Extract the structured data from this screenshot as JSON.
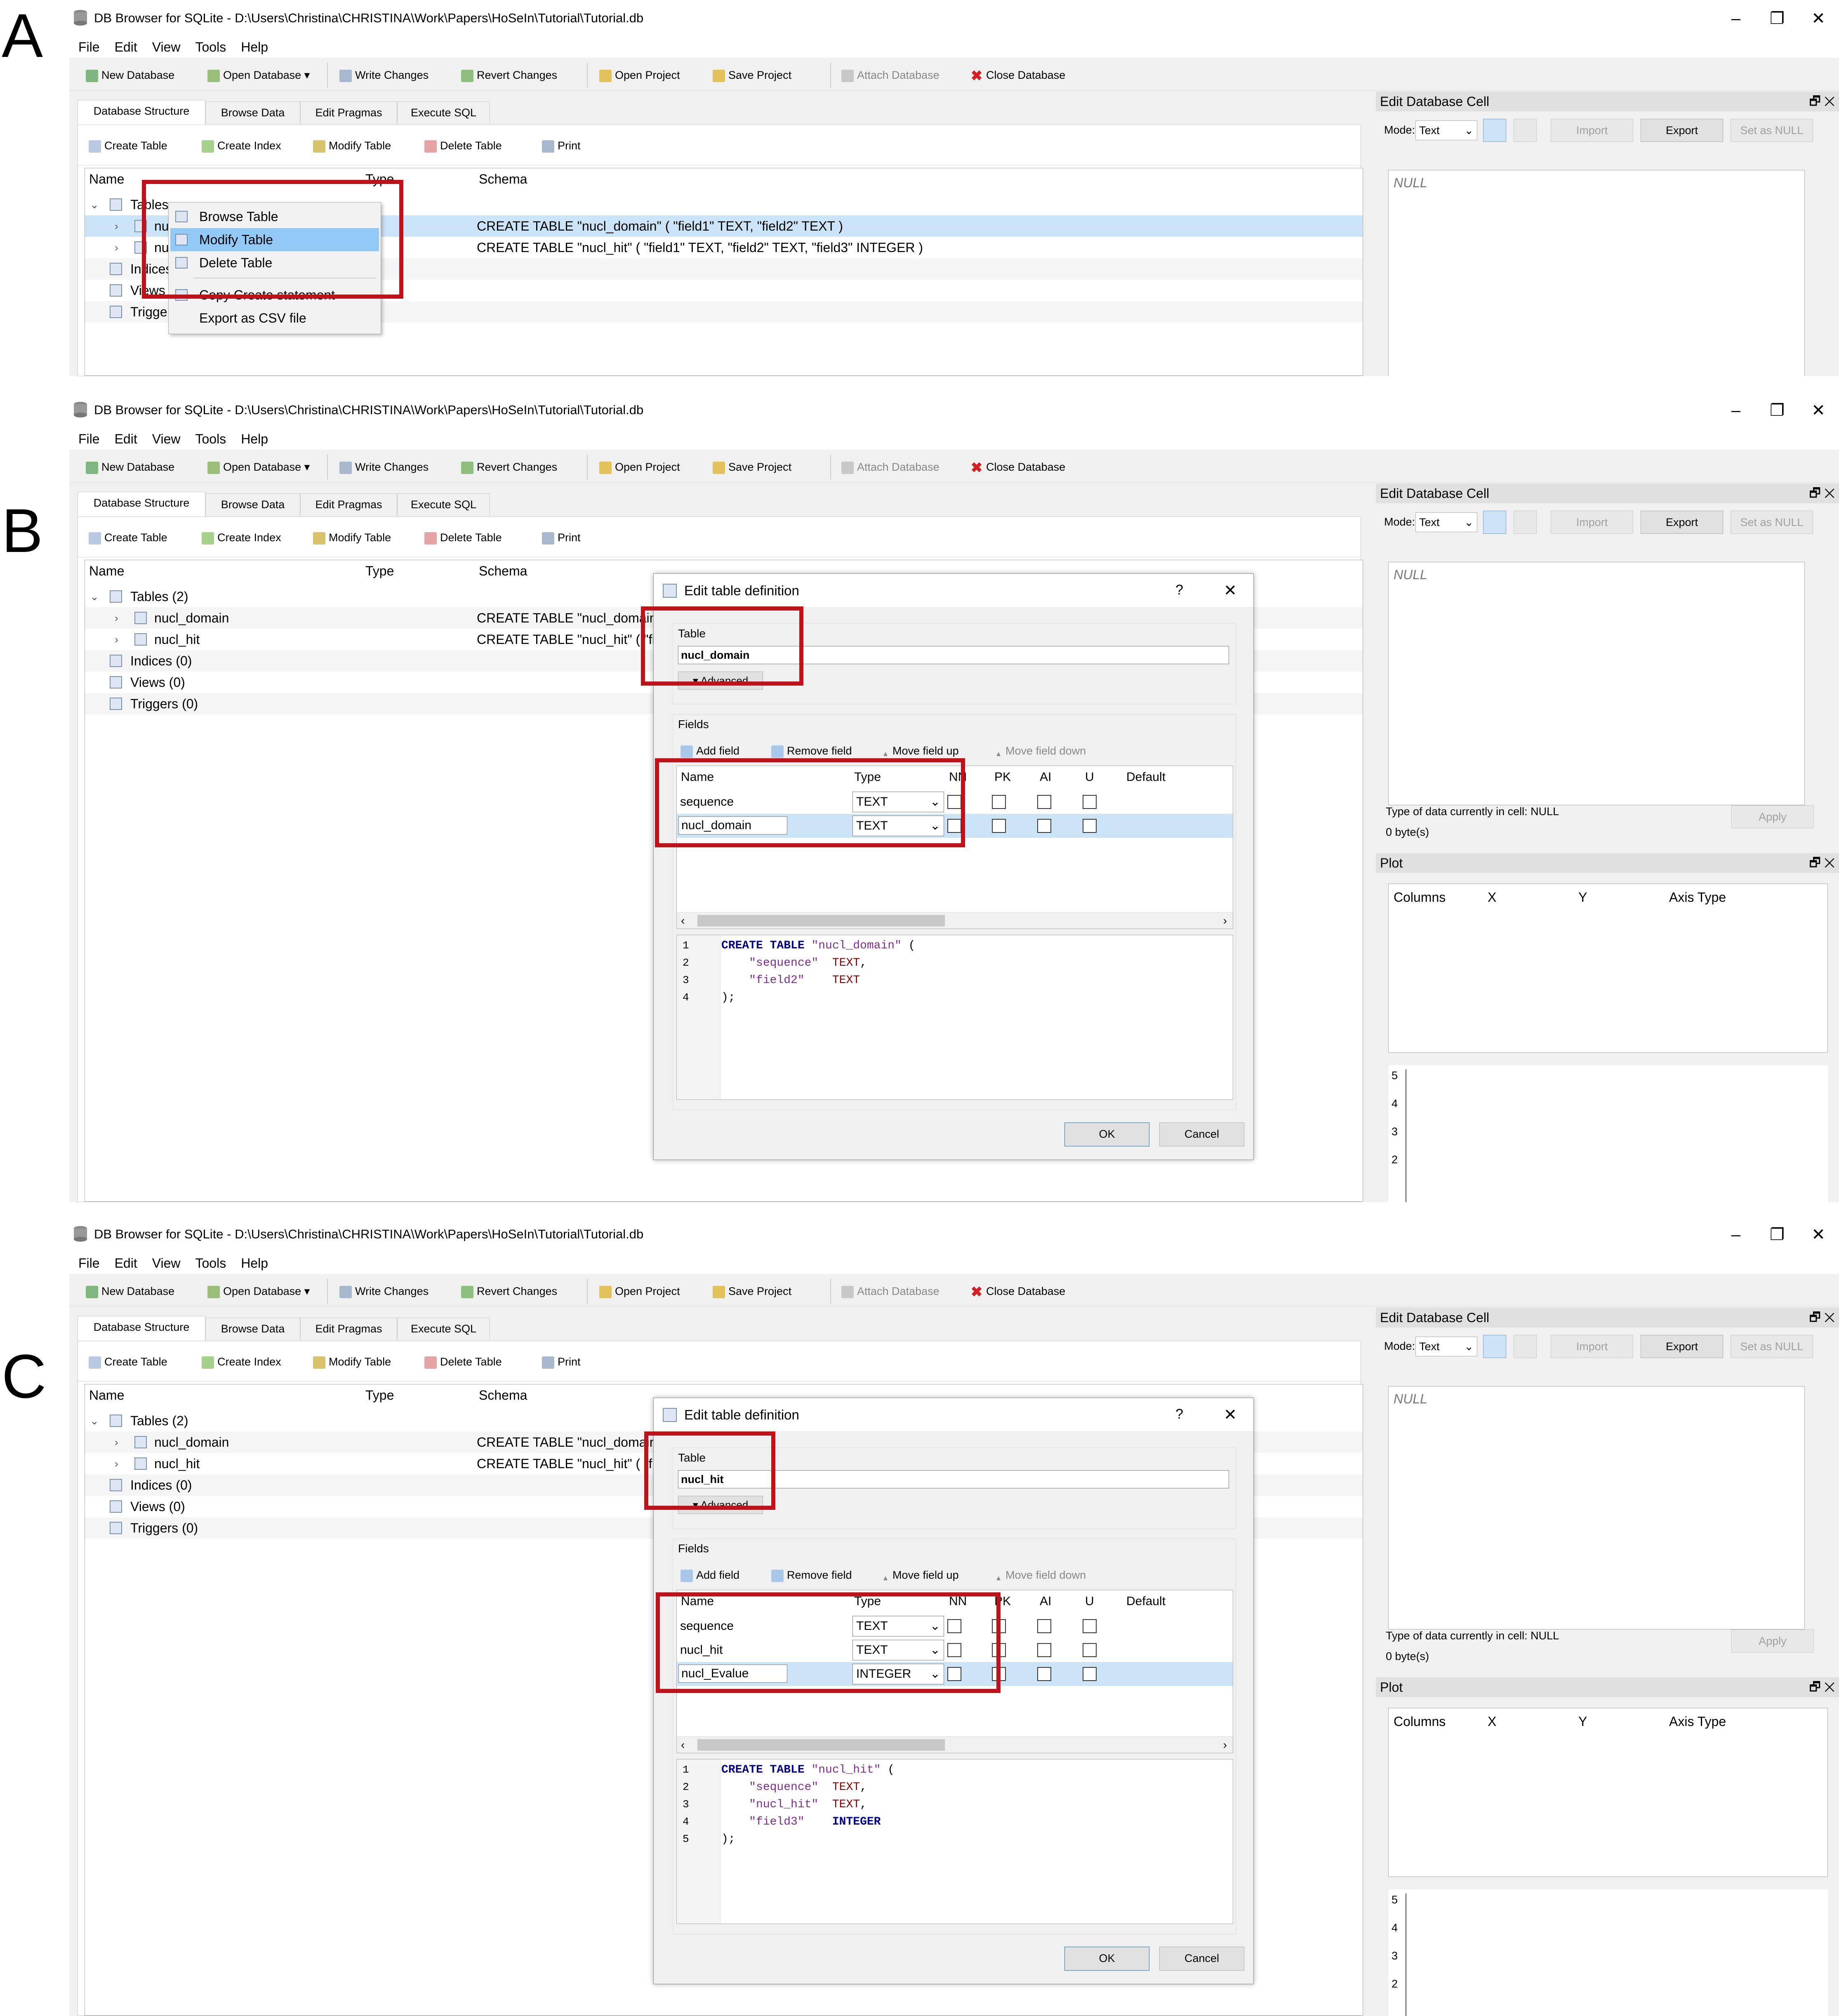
{
  "labels": {
    "a": "A",
    "b": "B",
    "c": "C"
  },
  "window": {
    "title": "DB Browser for SQLite - D:\\Users\\Christina\\CHRISTINA\\Work\\Papers\\HoSeIn\\Tutorial\\Tutorial.db",
    "minimize": "–",
    "restore": "❐",
    "close": "✕"
  },
  "menu": [
    "File",
    "Edit",
    "View",
    "Tools",
    "Help"
  ],
  "toolbar": {
    "new_db": "New Database",
    "open_db": "Open Database",
    "write": "Write Changes",
    "revert": "Revert Changes",
    "open_project": "Open Project",
    "save_project": "Save Project",
    "attach": "Attach Database",
    "close_db": "Close Database"
  },
  "tabs": [
    "Database Structure",
    "Browse Data",
    "Edit Pragmas",
    "Execute SQL"
  ],
  "subtoolbar": {
    "create_table": "Create Table",
    "create_index": "Create Index",
    "modify_table": "Modify Table",
    "delete_table": "Delete Table",
    "print": "Print"
  },
  "tree": {
    "col_name": "Name",
    "col_type": "Type",
    "col_schema": "Schema",
    "tables": "Tables (2)",
    "tables_short": "Tables",
    "t1": "nucl_domain",
    "t2": "nucl_hit",
    "t_short": "nu",
    "indices": "Indices (0)",
    "indices_short": "Indices",
    "views": "Views (0)",
    "views_short": "Views",
    "triggers": "Triggers (0)",
    "triggers_short": "Trigge",
    "schema1_full": "CREATE TABLE \"nucl_domain\" ( \"field1\" TEXT, \"field2\" TEXT )",
    "schema2_full": "CREATE TABLE \"nucl_hit\" ( \"field1\" TEXT, \"field2\" TEXT, \"field3\" INTEGER )",
    "schema1_cut": "CREATE TABLE \"nucl_domain\"",
    "schema2_cut_b": "CREATE TABLE \"nucl_hit\" ( \"fi",
    "schema2_cut_c": "CREATE TABLE \"nucl_hit\" ( \"f"
  },
  "context_menu": {
    "browse": "Browse Table",
    "modify": "Modify Table",
    "delete": "Delete Table",
    "copy": "Copy Create statement",
    "export": "Export as CSV file"
  },
  "edit_cell": {
    "title": "Edit Database Cell",
    "dock_btns": "🗗  ✕",
    "mode_label": "Mode:",
    "mode_value": "Text",
    "import": "Import",
    "export": "Export",
    "set_null": "Set as NULL",
    "null": "NULL",
    "type_info": "Type of data currently in cell: NULL",
    "bytes": "0 byte(s)",
    "apply": "Apply"
  },
  "plot": {
    "title": "Plot",
    "columns": "Columns",
    "x": "X",
    "y": "Y",
    "axis_type": "Axis Type",
    "ticks": [
      "5",
      "4",
      "3",
      "2"
    ]
  },
  "dialog": {
    "title": "Edit table definition",
    "help": "?",
    "close": "✕",
    "table_label": "Table",
    "advanced": "▾ Advanced",
    "fields_label": "Fields",
    "add_field": "Add field",
    "remove_field": "Remove field",
    "move_up": "Move field up",
    "move_down": "Move field down",
    "cols": {
      "name": "Name",
      "type": "Type",
      "nn": "NN",
      "pk": "PK",
      "ai": "AI",
      "u": "U",
      "default": "Default"
    },
    "ok": "OK",
    "cancel": "Cancel"
  },
  "dialog_b": {
    "table_name": "nucl_domain",
    "fields": [
      {
        "name": "sequence",
        "type": "TEXT"
      },
      {
        "name": "nucl_domain",
        "type": "TEXT"
      }
    ],
    "code": [
      {
        "n": "1",
        "parts": [
          [
            "kw",
            "CREATE TABLE "
          ],
          [
            "str",
            "\"nucl_domain\""
          ],
          [
            "",
            " ("
          ]
        ]
      },
      {
        "n": "2",
        "parts": [
          [
            "",
            "    "
          ],
          [
            "str",
            "\"sequence\""
          ],
          [
            "",
            "  "
          ],
          [
            "ty",
            "TEXT"
          ],
          [
            "",
            ","
          ]
        ]
      },
      {
        "n": "3",
        "parts": [
          [
            "",
            "    "
          ],
          [
            "str",
            "\"field2\""
          ],
          [
            "",
            "    "
          ],
          [
            "ty",
            "TEXT"
          ]
        ]
      },
      {
        "n": "4",
        "parts": [
          [
            "",
            ");"
          ]
        ]
      }
    ]
  },
  "dialog_c": {
    "table_name": "nucl_hit",
    "fields": [
      {
        "name": "sequence",
        "type": "TEXT"
      },
      {
        "name": "nucl_hit",
        "type": "TEXT"
      },
      {
        "name": "nucl_Evalue",
        "type": "INTEGER"
      }
    ],
    "code": [
      {
        "n": "1",
        "parts": [
          [
            "kw",
            "CREATE TABLE "
          ],
          [
            "str",
            "\"nucl_hit\""
          ],
          [
            "",
            " ("
          ]
        ]
      },
      {
        "n": "2",
        "parts": [
          [
            "",
            "    "
          ],
          [
            "str",
            "\"sequence\""
          ],
          [
            "",
            "  "
          ],
          [
            "ty",
            "TEXT"
          ],
          [
            "",
            ","
          ]
        ]
      },
      {
        "n": "3",
        "parts": [
          [
            "",
            "    "
          ],
          [
            "str",
            "\"nucl_hit\""
          ],
          [
            "",
            "  "
          ],
          [
            "ty",
            "TEXT"
          ],
          [
            "",
            ","
          ]
        ]
      },
      {
        "n": "4",
        "parts": [
          [
            "",
            "    "
          ],
          [
            "str",
            "\"field3\""
          ],
          [
            "",
            "    "
          ],
          [
            "kw",
            "INTEGER"
          ]
        ]
      },
      {
        "n": "5",
        "parts": [
          [
            "",
            ");"
          ]
        ]
      }
    ]
  },
  "colors": {
    "highlight_box": "#c0121b",
    "selection": "#cce4f7",
    "menu_hover": "#91c9f7"
  }
}
